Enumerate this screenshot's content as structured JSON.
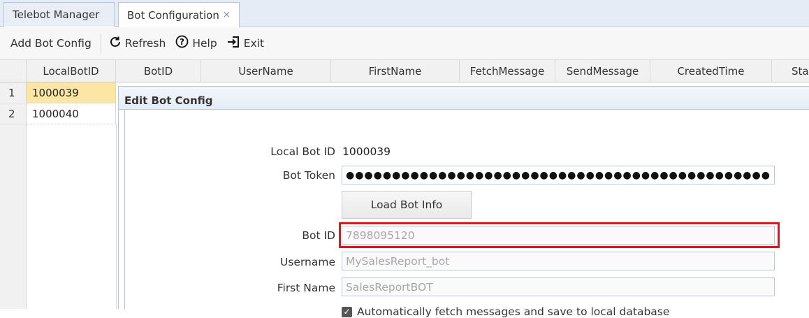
{
  "tabs": [
    {
      "label": "Telebot Manager",
      "active": false
    },
    {
      "label": "Bot Configuration",
      "active": true,
      "close": "×"
    }
  ],
  "toolbar": {
    "add": "Add Bot Config",
    "refresh": "Refresh",
    "help": "Help",
    "exit": "Exit"
  },
  "grid": {
    "columns": [
      "LocalBotID",
      "BotID",
      "UserName",
      "FirstName",
      "FetchMessage",
      "SendMessage",
      "CreatedTime",
      "Sta"
    ],
    "rows": [
      {
        "num": "1",
        "local_bot_id": "1000039"
      },
      {
        "num": "2",
        "local_bot_id": "1000040"
      }
    ]
  },
  "panel": {
    "title": "Edit Bot Config",
    "local_bot_id_label": "Local Bot ID",
    "local_bot_id_value": "1000039",
    "bot_token_label": "Bot Token",
    "bot_token_value": "●●●●●●●●●●●●●●●●●●●●●●●●●●●●●●●●●●●●●●●●●●●●●●",
    "load_button": "Load Bot Info",
    "bot_id_label": "Bot ID",
    "bot_id_value": "7898095120",
    "username_label": "Username",
    "username_value": "MySalesReport_bot",
    "first_name_label": "First Name",
    "first_name_value": "SalesReportBOT",
    "auto_fetch_label": "Automatically fetch messages and save to local database"
  },
  "colors": {
    "highlight": "#e0141c",
    "selected_row": "#fbe6a6"
  }
}
